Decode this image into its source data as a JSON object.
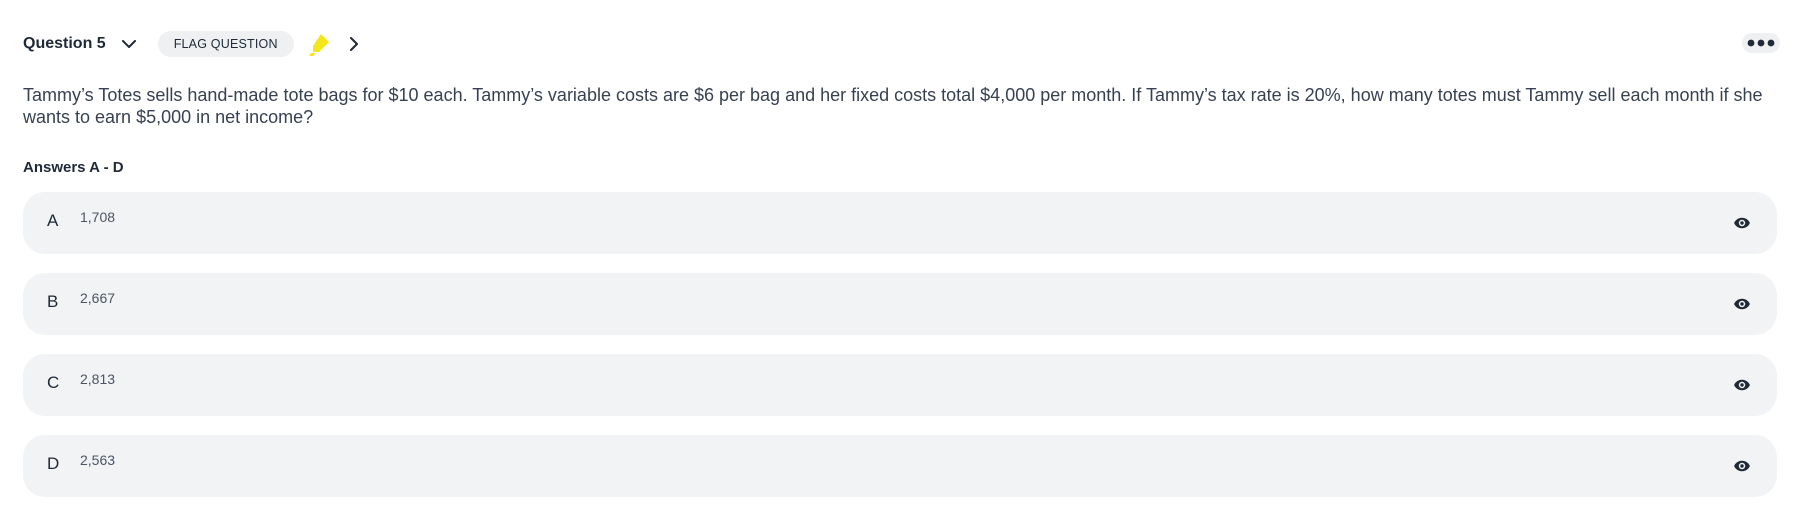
{
  "header": {
    "question_title": "Question 5",
    "flag_label": "FLAG QUESTION",
    "highlighter_color": "#f5e61b"
  },
  "question": {
    "text": "Tammy’s Totes sells hand-made tote bags for $10 each. Tammy’s variable costs are $6 per bag and her fixed costs total $4,000 per month. If Tammy’s tax rate is 20%, how many totes must Tammy sell each month if she wants to earn $5,000 in net income?"
  },
  "answers": {
    "label": "Answers A - D",
    "items": [
      {
        "letter": "A",
        "value": "1,708"
      },
      {
        "letter": "B",
        "value": "2,667"
      },
      {
        "letter": "C",
        "value": "2,813"
      },
      {
        "letter": "D",
        "value": "2,563"
      }
    ]
  },
  "icons": {
    "chevron_down": "chevron-down-icon",
    "highlighter": "highlighter-icon",
    "chevron_right": "chevron-right-icon",
    "more": "more-icon",
    "eye": "eye-icon"
  }
}
